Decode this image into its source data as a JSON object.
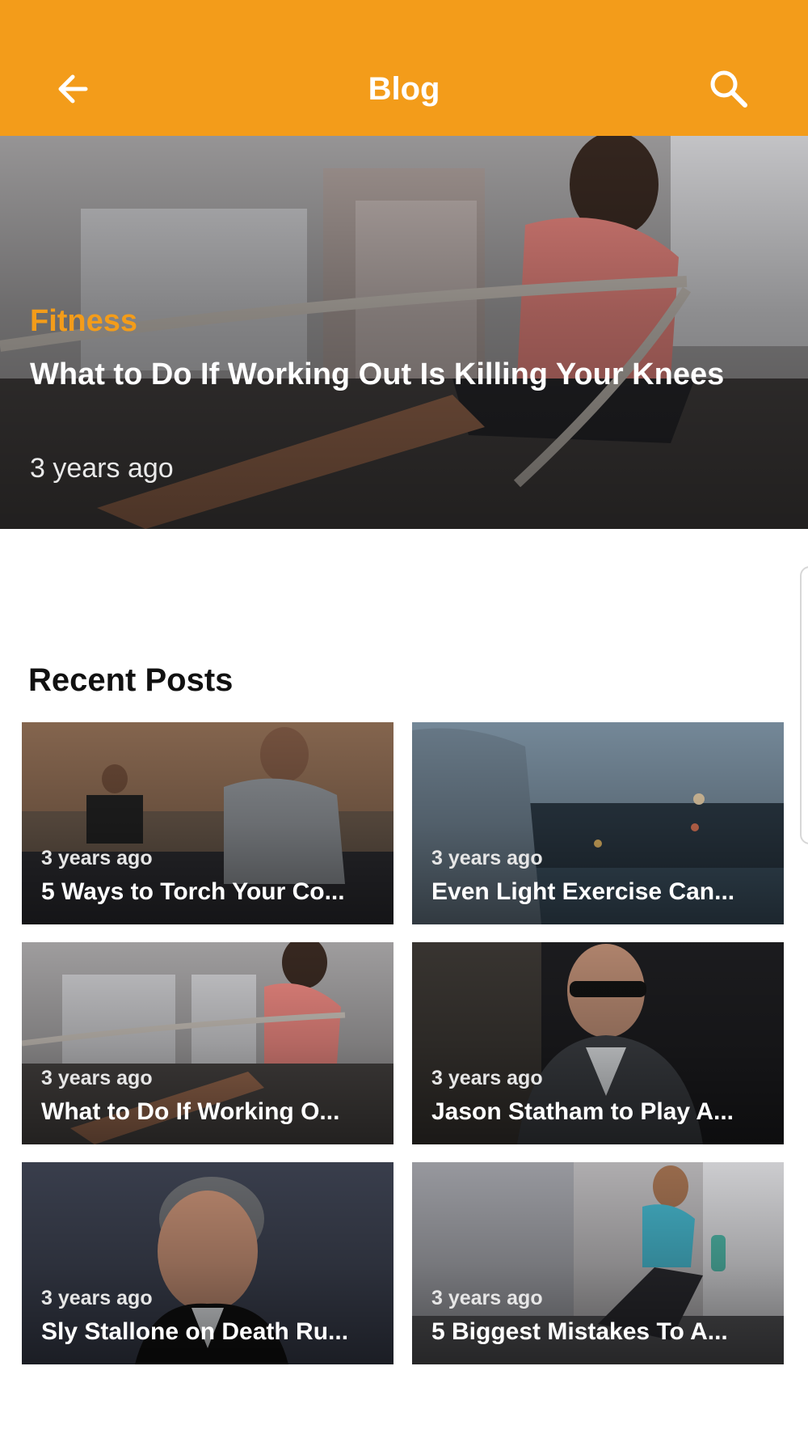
{
  "appbar": {
    "title": "Blog",
    "back_icon": "arrow-left-icon",
    "search_icon": "search-icon",
    "color": "#F39C1A"
  },
  "featured": {
    "category": "Fitness",
    "title": "What to Do If Working Out Is Killing Your Knees",
    "time": "3 years ago",
    "category_color": "#F39C1A"
  },
  "recent": {
    "heading": "Recent Posts",
    "posts": [
      {
        "time": "3 years ago",
        "title": "5 Ways to Torch Your Co..."
      },
      {
        "time": "3 years ago",
        "title": "Even Light Exercise Can..."
      },
      {
        "time": "3 years ago",
        "title": "What to Do If Working O..."
      },
      {
        "time": "3 years ago",
        "title": "Jason Statham to Play A..."
      },
      {
        "time": "3 years ago",
        "title": "Sly Stallone on Death Ru..."
      },
      {
        "time": "3 years ago",
        "title": "5 Biggest Mistakes To A..."
      }
    ]
  }
}
